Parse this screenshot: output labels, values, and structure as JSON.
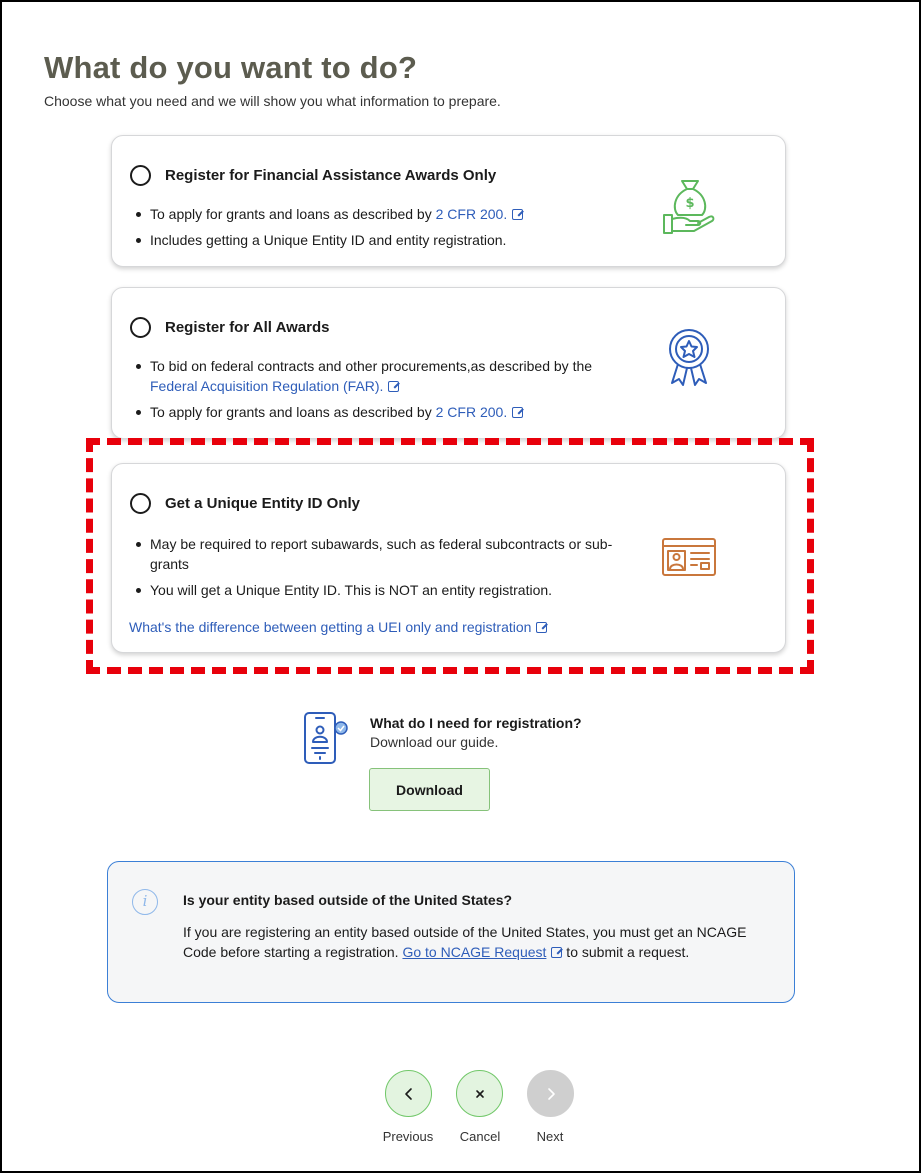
{
  "header": {
    "title": "What do you want to do?",
    "subtitle": "Choose what you need and we will show you what information to prepare."
  },
  "options": [
    {
      "title": "Register for Financial Assistance Awards Only",
      "bullet1_text": "To apply for grants and loans as described by ",
      "bullet1_link": "2 CFR 200.",
      "bullet2_text": "Includes getting a Unique Entity ID and entity registration.",
      "icon": "money-bag-hand-icon"
    },
    {
      "title": "Register for All Awards",
      "bullet1_text": "To bid on federal contracts and other procurements,as described by the ",
      "bullet1_link": "Federal Acquisition Regulation (FAR).",
      "bullet2_text": "To apply for grants and loans as described by ",
      "bullet2_link": "2 CFR 200.",
      "icon": "award-ribbon-icon"
    },
    {
      "title": "Get a Unique Entity ID Only",
      "bullet1_text": "May be required to report subawards, such as federal subcontracts or sub-grants",
      "bullet2_text": "You will get a Unique Entity ID. This is NOT an entity registration.",
      "link": "What's the difference between getting a UEI only and registration",
      "icon": "id-card-icon"
    }
  ],
  "guide": {
    "title": "What do I need for registration?",
    "subtitle": "Download our guide.",
    "button": "Download",
    "icon": "mobile-guide-icon"
  },
  "info": {
    "title": "Is your entity based outside of the United States?",
    "body_before": "If you are registering an entity based outside of the United States, you must get an NCAGE Code before starting a registration. ",
    "link": "Go to NCAGE Request",
    "body_after": " to submit a request.",
    "icon": "info-icon"
  },
  "nav": {
    "previous": "Previous",
    "cancel": "Cancel",
    "next": "Next"
  },
  "colors": {
    "link": "#2e5db9",
    "highlight": "#e8000b",
    "accent_green": "#70c768",
    "info_border": "#3b7fd6"
  }
}
